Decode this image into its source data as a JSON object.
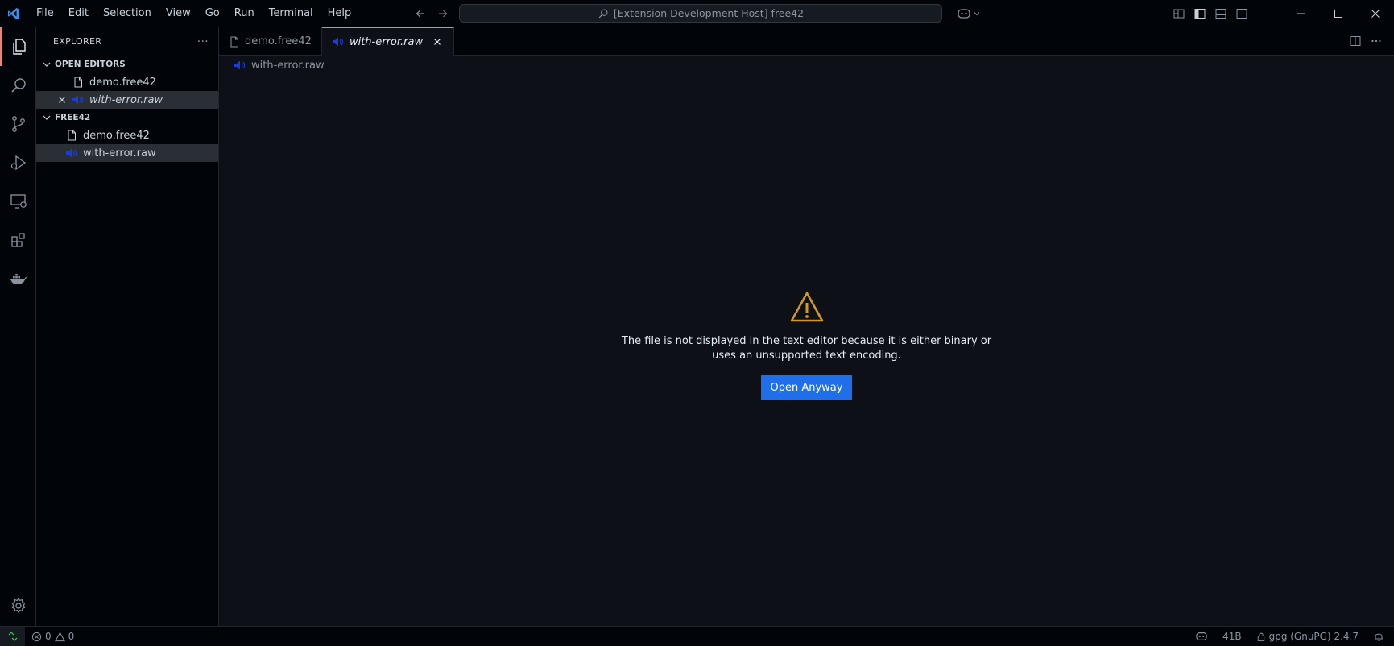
{
  "titlebar": {
    "menus": [
      "File",
      "Edit",
      "Selection",
      "View",
      "Go",
      "Run",
      "Terminal",
      "Help"
    ],
    "command_center": "[Extension Development Host] free42"
  },
  "sidebar": {
    "title": "EXPLORER",
    "more": "···",
    "open_editors_label": "OPEN EDITORS",
    "open_editors": [
      {
        "label": "demo.free42",
        "icon": "file-icon"
      },
      {
        "label": "with-error.raw",
        "icon": "speaker-icon"
      }
    ],
    "folder_label": "FREE42",
    "files": [
      {
        "label": "demo.free42",
        "icon": "file-icon"
      },
      {
        "label": "with-error.raw",
        "icon": "speaker-icon"
      }
    ]
  },
  "tabs": [
    {
      "label": "demo.free42",
      "icon": "file-icon",
      "active": false
    },
    {
      "label": "with-error.raw",
      "icon": "speaker-icon",
      "active": true
    }
  ],
  "breadcrumb": "with-error.raw",
  "editor": {
    "message": "The file is not displayed in the text editor because it is either binary or uses an unsupported text encoding.",
    "button": "Open Anyway"
  },
  "statusbar": {
    "errors": "0",
    "warnings": "0",
    "size": "41B",
    "gpg": "gpg (GnuPG) 2.4.7"
  },
  "colors": {
    "accent_button": "#1f6feb",
    "warning_icon": "#d29922",
    "active_tab_border": "#f78166",
    "speaker_icon": "#1f3bd6"
  }
}
